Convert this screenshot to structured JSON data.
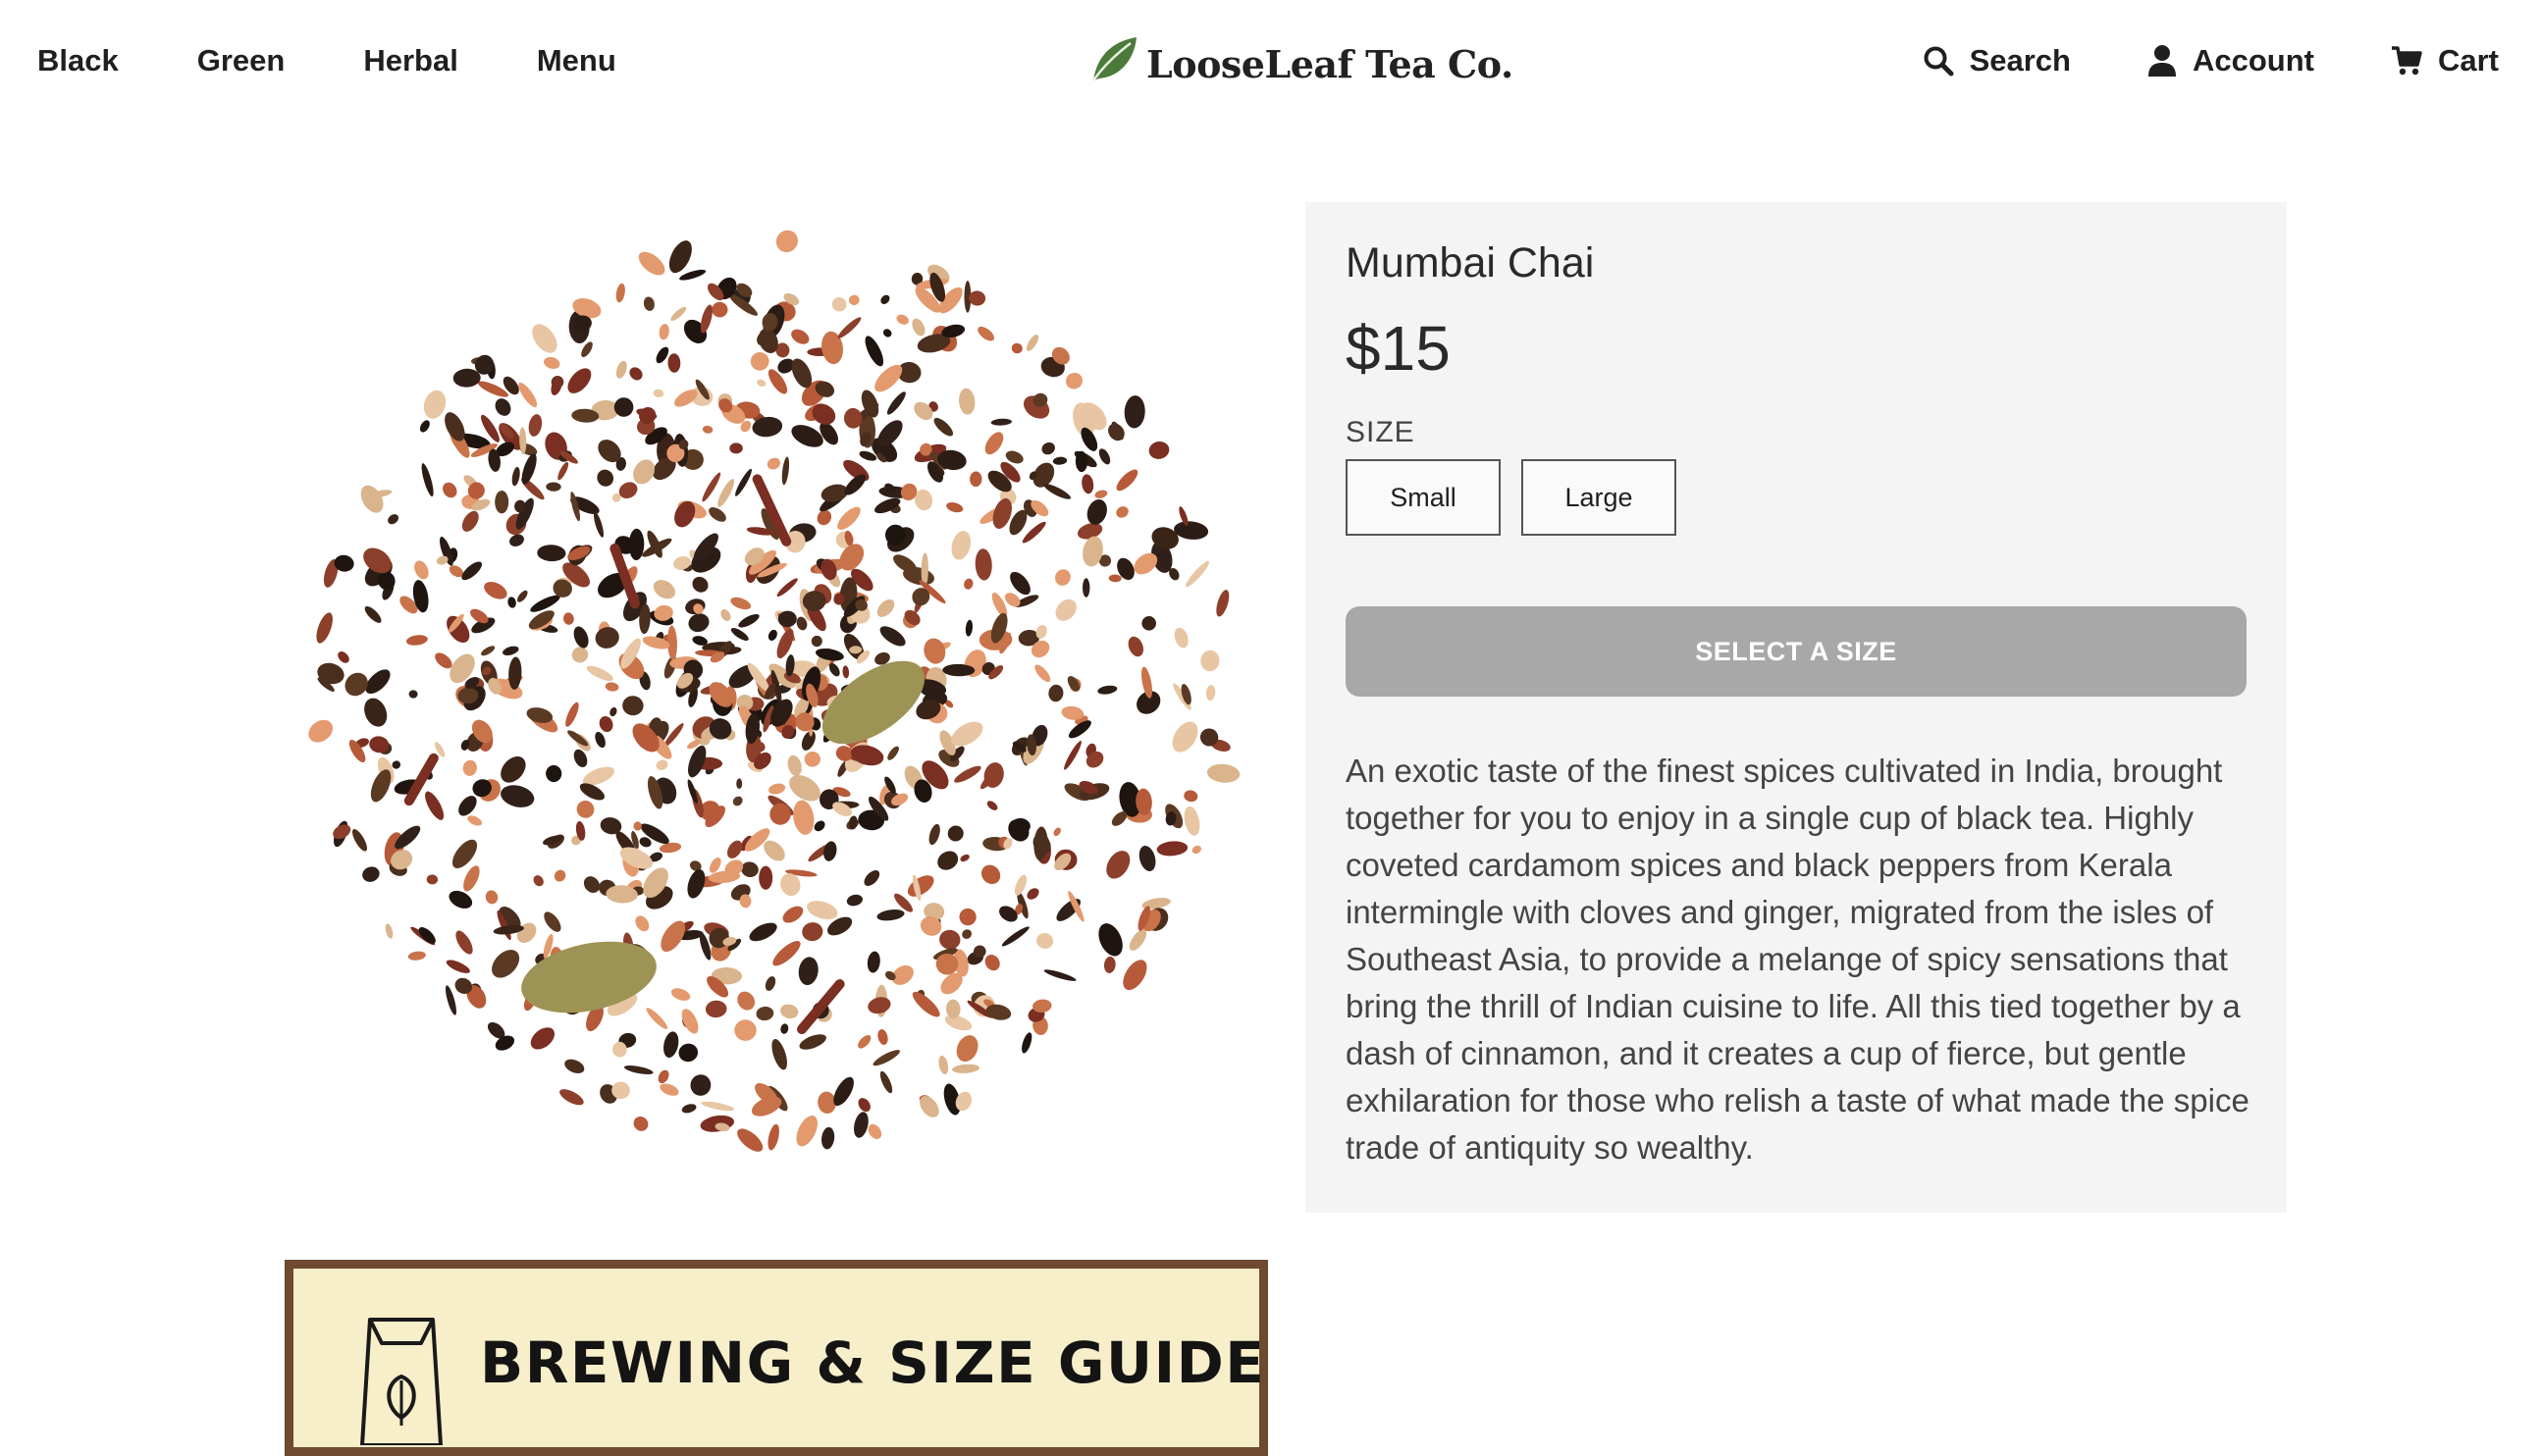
{
  "header": {
    "nav_left": [
      "Black",
      "Green",
      "Herbal",
      "Menu"
    ],
    "logo_text": "LooseLeaf Tea Co.",
    "logo_icon": "leaf-icon",
    "nav_right": [
      {
        "label": "Search",
        "icon": "search-icon"
      },
      {
        "label": "Account",
        "icon": "user-icon"
      },
      {
        "label": "Cart",
        "icon": "cart-icon"
      }
    ]
  },
  "product": {
    "name": "Mumbai Chai",
    "price": "$15",
    "size_label": "SIZE",
    "sizes": [
      "Small",
      "Large"
    ],
    "cta_label": "SELECT A SIZE",
    "description": "An exotic taste of the finest spices cultivated in India, brought together for you to enjoy in a single cup of black tea. Highly coveted cardamom spices and black peppers from Kerala intermingle with cloves and ginger, migrated from the isles of Southeast Asia, to provide a melange of spicy sensations that bring the thrill of Indian cuisine to life. All this tied together by a dash of cinnamon, and it creates a cup of fierce, but gentle exhilaration for those who relish a taste of what made the spice trade of antiquity so wealthy.",
    "image_icon": "loose-leaf-tea-blend-image"
  },
  "guide": {
    "title": "BREWING & SIZE GUIDE",
    "icon": "tea-bag-icon"
  },
  "colors": {
    "panel_bg": "#f4f4f4",
    "cta_bg": "#a8a8a8",
    "guide_bg": "#f7efca",
    "guide_border": "#6e4a30",
    "leaf": "#4c7a3a"
  }
}
